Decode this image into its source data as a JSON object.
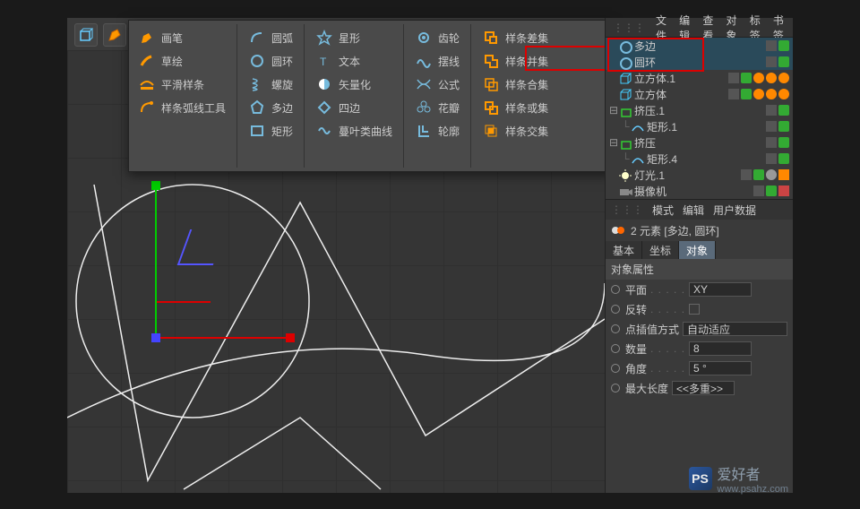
{
  "popup": {
    "col1": [
      {
        "icon": "pen-orange",
        "label": "画笔"
      },
      {
        "icon": "sketch-orange",
        "label": "草绘"
      },
      {
        "icon": "smooth-orange",
        "label": "平滑样条"
      },
      {
        "icon": "arc-tool-orange",
        "label": "样条弧线工具"
      }
    ],
    "col2": [
      {
        "icon": "arc-blue",
        "label": "圆弧"
      },
      {
        "icon": "circle-blue",
        "label": "圆环"
      },
      {
        "icon": "helix-blue",
        "label": "螺旋"
      },
      {
        "icon": "polygon-blue",
        "label": "多边"
      },
      {
        "icon": "rect-blue",
        "label": "矩形"
      }
    ],
    "col3": [
      {
        "icon": "star-blue",
        "label": "星形"
      },
      {
        "icon": "text-blue",
        "label": "文本"
      },
      {
        "icon": "vectorize-blue",
        "label": "矢量化"
      },
      {
        "icon": "quad-blue",
        "label": "四边"
      },
      {
        "icon": "cissoid-blue",
        "label": "蔓叶类曲线"
      }
    ],
    "col4": [
      {
        "icon": "cogwheel-blue",
        "label": "齿轮"
      },
      {
        "icon": "cycloid-blue",
        "label": "摆线"
      },
      {
        "icon": "formula-blue",
        "label": "公式"
      },
      {
        "icon": "flower-blue",
        "label": "花瓣"
      },
      {
        "icon": "profile-blue",
        "label": "轮廓"
      }
    ],
    "col5": [
      {
        "icon": "subtract-orange",
        "label": "样条差集"
      },
      {
        "icon": "union-orange",
        "label": "样条并集"
      },
      {
        "icon": "and-orange",
        "label": "样条合集"
      },
      {
        "icon": "or-orange",
        "label": "样条或集"
      },
      {
        "icon": "intersect-orange",
        "label": "样条交集"
      }
    ]
  },
  "om": {
    "menu": [
      "文件",
      "编辑",
      "查看",
      "对象",
      "标签",
      "书签"
    ],
    "items": [
      {
        "icon": "circle-blue",
        "name": "多边",
        "sel": true
      },
      {
        "icon": "circle-blue",
        "name": "圆环",
        "sel": true
      },
      {
        "icon": "cube-cyan",
        "name": "立方体.1",
        "dots": 3
      },
      {
        "icon": "cube-cyan",
        "name": "立方体",
        "dots": 3
      },
      {
        "icon": "extrude-green",
        "name": "挤压.1",
        "exp": true
      },
      {
        "icon": "spline-blue",
        "name": "矩形.1",
        "ind": 1
      },
      {
        "icon": "extrude-green",
        "name": "挤压",
        "exp": true
      },
      {
        "icon": "spline-blue",
        "name": "矩形.4",
        "ind": 1
      },
      {
        "icon": "light",
        "name": "灯光.1",
        "tag": "shadow"
      },
      {
        "icon": "camera",
        "name": "摄像机",
        "tag": "target"
      }
    ]
  },
  "attr": {
    "menu": [
      "模式",
      "编辑",
      "用户数据"
    ],
    "element": "2 元素 [多边, 圆环]",
    "tabs": [
      "基本",
      "坐标",
      "对象"
    ],
    "section": "对象属性",
    "props": {
      "plane_label": "平面",
      "plane_value": "XY",
      "reverse_label": "反转",
      "interp_label": "点插值方式",
      "interp_value": "自动适应",
      "count_label": "数量",
      "count_value": "8",
      "angle_label": "角度",
      "angle_value": "5 °",
      "maxlen_label": "最大长度",
      "maxlen_value": "<<多重>>"
    }
  },
  "watermark": {
    "brand": "PS",
    "name": "爱好者",
    "url": "www.psahz.com"
  }
}
